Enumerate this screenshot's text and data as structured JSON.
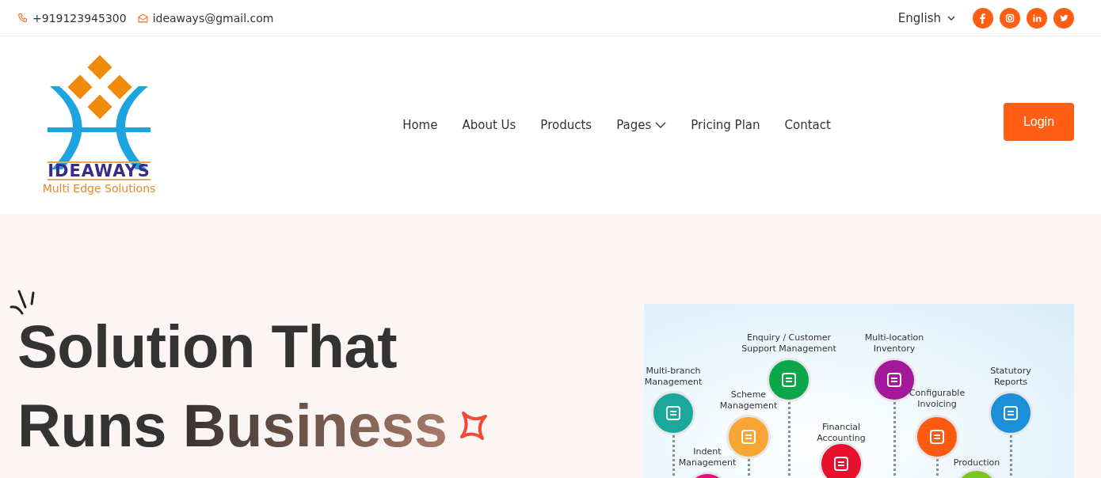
{
  "top_bar": {
    "phone": "+919123945300",
    "email": "ideaways@gmail.com",
    "language": "English",
    "social": [
      {
        "kind": "facebook"
      },
      {
        "kind": "instagram"
      },
      {
        "kind": "linkedin"
      },
      {
        "kind": "twitter"
      }
    ]
  },
  "logo": {
    "name": "IDEAWAYS",
    "tagline": "Multi Edge Solutions"
  },
  "nav": [
    {
      "label": "Home",
      "dropdown": false
    },
    {
      "label": "About Us",
      "dropdown": false
    },
    {
      "label": "Products",
      "dropdown": false
    },
    {
      "label": "Pages",
      "dropdown": true
    },
    {
      "label": "Pricing Plan",
      "dropdown": false
    },
    {
      "label": "Contact",
      "dropdown": false
    }
  ],
  "login": "Login",
  "hero": {
    "title_line_1": "Solution That",
    "title_line_2_plain": "Runs ",
    "title_line_2_accent": "Business"
  },
  "infographic": {
    "modules": [
      {
        "label": "Multi-branch Management",
        "color": "#1aa89a"
      },
      {
        "label": "Scheme Management",
        "color": "#f7a533"
      },
      {
        "label": "Indent Management",
        "color": "#e2127e"
      },
      {
        "label": "Enquiry / Customer Support Management",
        "color": "#0aa64a"
      },
      {
        "label": "Financial Accounting",
        "color": "#e8112d"
      },
      {
        "label": "Multi-location Inventory",
        "color": "#a3199a"
      },
      {
        "label": "Configurable Invoicing",
        "color": "#ff5a0f"
      },
      {
        "label": "Production",
        "color": "#7cc424"
      },
      {
        "label": "Statutory Reports",
        "color": "#1b8fd8"
      }
    ]
  }
}
